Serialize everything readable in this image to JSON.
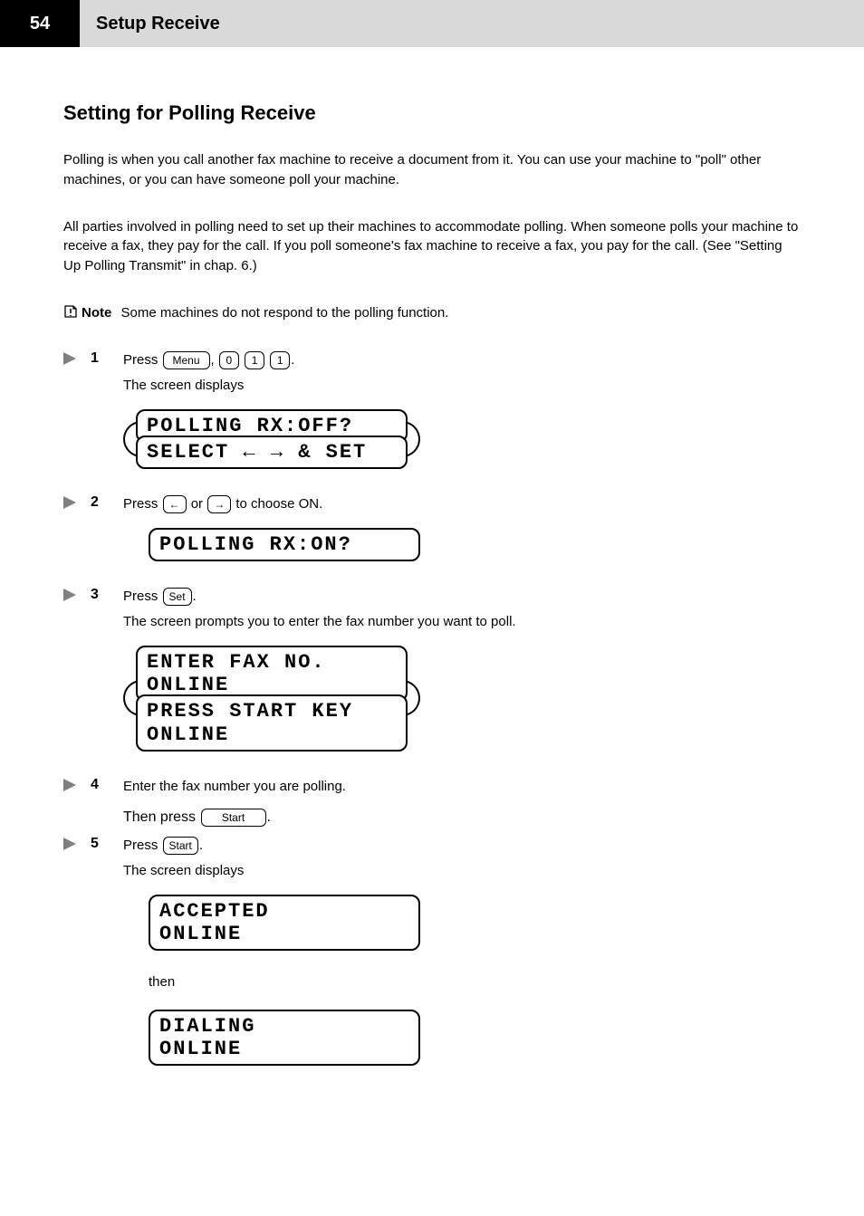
{
  "header": {
    "page_number": "54",
    "chapter": "Setup Receive"
  },
  "section": {
    "title": "Setting for Polling Receive",
    "intro": "Polling is when you call another fax machine to receive a document from it. You can use your machine to \"poll\" other machines, or you can have someone poll your machine.",
    "intro2": "All parties involved in polling need to set up their machines to accommodate polling. When someone polls your machine to receive a fax, they pay for the call. If you poll someone's fax machine to receive a fax, you pay for the call. (See \"Setting Up Polling Transmit\" in chap. 6.)"
  },
  "note": {
    "label": "Note",
    "text": "Some machines do not respond to the polling function."
  },
  "steps": {
    "s1": {
      "pre": "Press",
      "menu": "Menu",
      "comma": ",",
      "k1": "0",
      "k2": "1",
      "k3": "1",
      "post": ".",
      "desc": "The screen displays",
      "lcd_a": "POLLING RX:OFF?",
      "lcd_b": "SELECT ← → & SET"
    },
    "s2": {
      "pre": "Press",
      "or": "or",
      "post": "to choose ON.",
      "lcd": "POLLING RX:ON?"
    },
    "s3": {
      "pre": "Press",
      "set": "Set",
      "post": ".",
      "desc": "The screen prompts you to enter the fax number you want to poll.",
      "lcd_a1": "ENTER FAX NO.",
      "lcd_a2": "ONLINE",
      "lcd_b1": "PRESS START KEY",
      "lcd_b2": "ONLINE"
    },
    "s4": {
      "text": "Enter the fax number you are polling.",
      "sub": "Then press",
      "start": "Start",
      "post": "."
    },
    "s5": {
      "pre": "Press",
      "start": "Start",
      "post": ".",
      "desc": "The screen displays",
      "lcd_a1": "ACCEPTED",
      "lcd_a2": "ONLINE",
      "between": "then",
      "lcd_b1": "DIALING",
      "lcd_b2": "ONLINE"
    }
  },
  "keys": {
    "left": "←",
    "right": "→"
  }
}
